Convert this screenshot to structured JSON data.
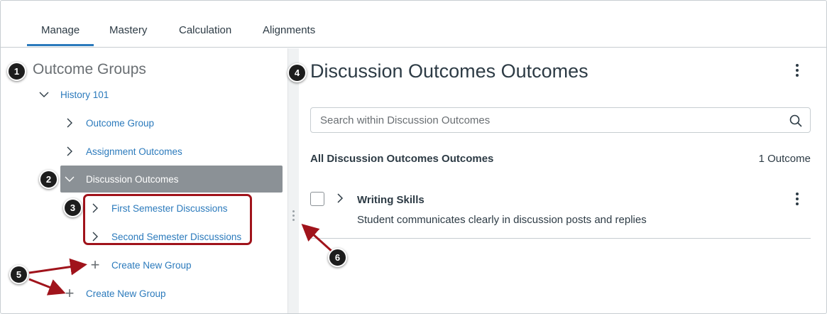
{
  "tabs": [
    {
      "label": "Manage",
      "active": true
    },
    {
      "label": "Mastery",
      "active": false
    },
    {
      "label": "Calculation",
      "active": false
    },
    {
      "label": "Alignments",
      "active": false
    }
  ],
  "sidebar": {
    "title": "Outcome Groups",
    "root": {
      "label": "History 101",
      "expanded": true
    },
    "items": [
      {
        "label": "Outcome Group",
        "expanded": false
      },
      {
        "label": "Assignment Outcomes",
        "expanded": false
      },
      {
        "label": "Discussion Outcomes",
        "expanded": true,
        "selected": true
      }
    ],
    "sub_items": [
      {
        "label": "First Semester Discussions"
      },
      {
        "label": "Second Semester Discussions"
      }
    ],
    "create_nested_label": "Create New Group",
    "create_root_label": "Create New Group"
  },
  "main": {
    "title": "Discussion Outcomes Outcomes",
    "search_placeholder": "Search within Discussion Outcomes",
    "list_title": "All Discussion Outcomes Outcomes",
    "count": "1 Outcome",
    "outcomes": [
      {
        "title": "Writing Skills",
        "description": "Student communicates clearly in discussion posts and replies",
        "checked": false
      }
    ]
  },
  "callouts": [
    "1",
    "2",
    "3",
    "4",
    "5",
    "6"
  ],
  "colors": {
    "accent": "#2b7abc",
    "selected_bg": "#8b9196",
    "annotation_red": "#a0131b",
    "callout_bg": "#1d1d1d"
  }
}
